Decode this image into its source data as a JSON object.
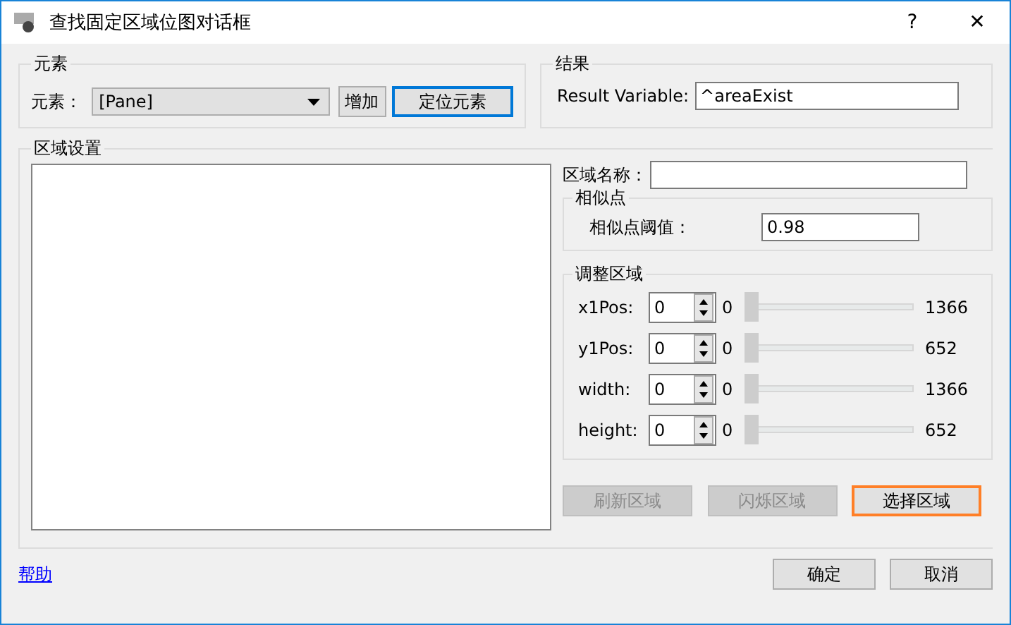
{
  "window": {
    "title": "查找固定区域位图对话框"
  },
  "title_buttons": [
    "?",
    "✕"
  ],
  "element_group": {
    "title": "元素",
    "label": "元素：",
    "dropdown_value": "[Pane]",
    "add_button": "增加",
    "locate_button": {
      "label": "定位元素",
      "focused": true
    }
  },
  "result_group": {
    "title": "结果",
    "label": "Result Variable:",
    "value": "^areaExist"
  },
  "area_settings": {
    "title": "区域设置",
    "name_label": "区域名称：",
    "similar": {
      "title": "相似点",
      "label": "相似点阈值：",
      "value": "0.98"
    },
    "adjust": {
      "title": "调整区域",
      "rows": [
        {
          "label": "x1Pos:",
          "value": "0",
          "min": "0",
          "max": "1366",
          "level": 0
        },
        {
          "label": "y1Pos:",
          "value": "0",
          "min": "0",
          "max": "652",
          "level": 0
        },
        {
          "label": "width:",
          "value": "0",
          "min": "0",
          "max": "1366",
          "level": 0
        },
        {
          "label": "height:",
          "value": "0",
          "min": "0",
          "max": "652",
          "level": 0
        }
      ]
    },
    "buttons": [
      {
        "label": "刷新区域",
        "disabled": true,
        "focused": false
      },
      {
        "label": "闪烁区域",
        "disabled": true,
        "focused": false
      },
      {
        "label": "选择区域",
        "disabled": false,
        "focused": true
      }
    ]
  },
  "help_link": "帮助",
  "footer_buttons": [
    "确定",
    "取消"
  ]
}
